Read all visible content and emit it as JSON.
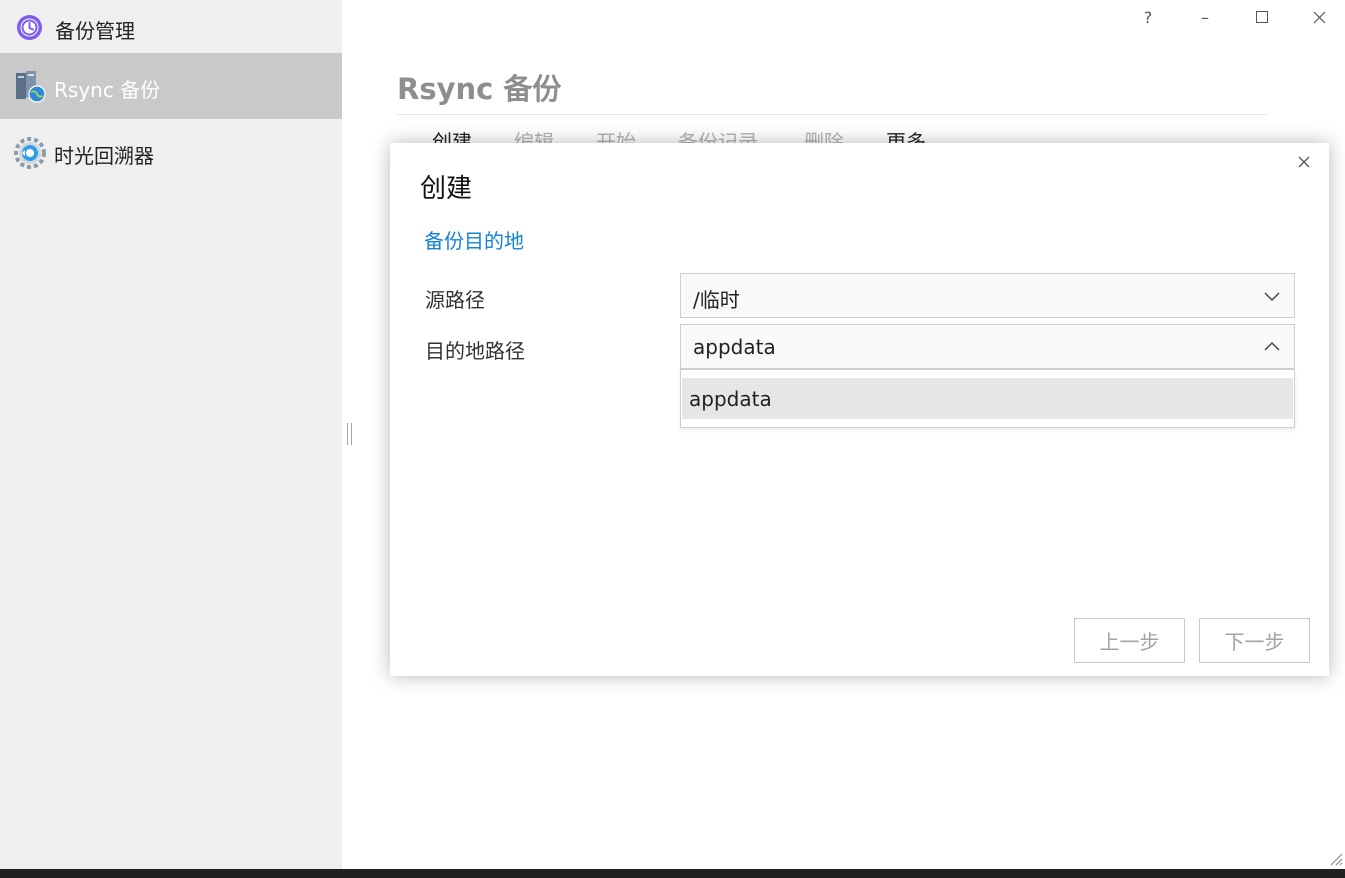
{
  "app": {
    "title": "备份管理"
  },
  "sidebar": {
    "items": [
      {
        "label": "Rsync 备份",
        "icon": "server-globe-icon",
        "active": true
      },
      {
        "label": "时光回溯器",
        "icon": "time-machine-gear-icon",
        "active": false
      }
    ]
  },
  "window_controls": {
    "help": "?",
    "minimize": "–",
    "maximize": "☐",
    "close": "✕"
  },
  "main": {
    "title": "Rsync 备份",
    "toolbar": [
      "创建",
      "编辑",
      "开始",
      "备份记录",
      "删除",
      "更多"
    ]
  },
  "dialog": {
    "title": "创建",
    "close": "✕",
    "step_title": "备份目的地",
    "fields": {
      "source_label": "源路径",
      "source_value": "/临时",
      "dest_label": "目的地路径",
      "dest_value": "appdata"
    },
    "dropdown_options": [
      "appdata"
    ],
    "buttons": {
      "prev": "上一步",
      "next": "下一步"
    }
  },
  "colors": {
    "accent": "#1683d2",
    "sidebar_bg": "#efefef",
    "sidebar_active": "#c9c9c9"
  }
}
